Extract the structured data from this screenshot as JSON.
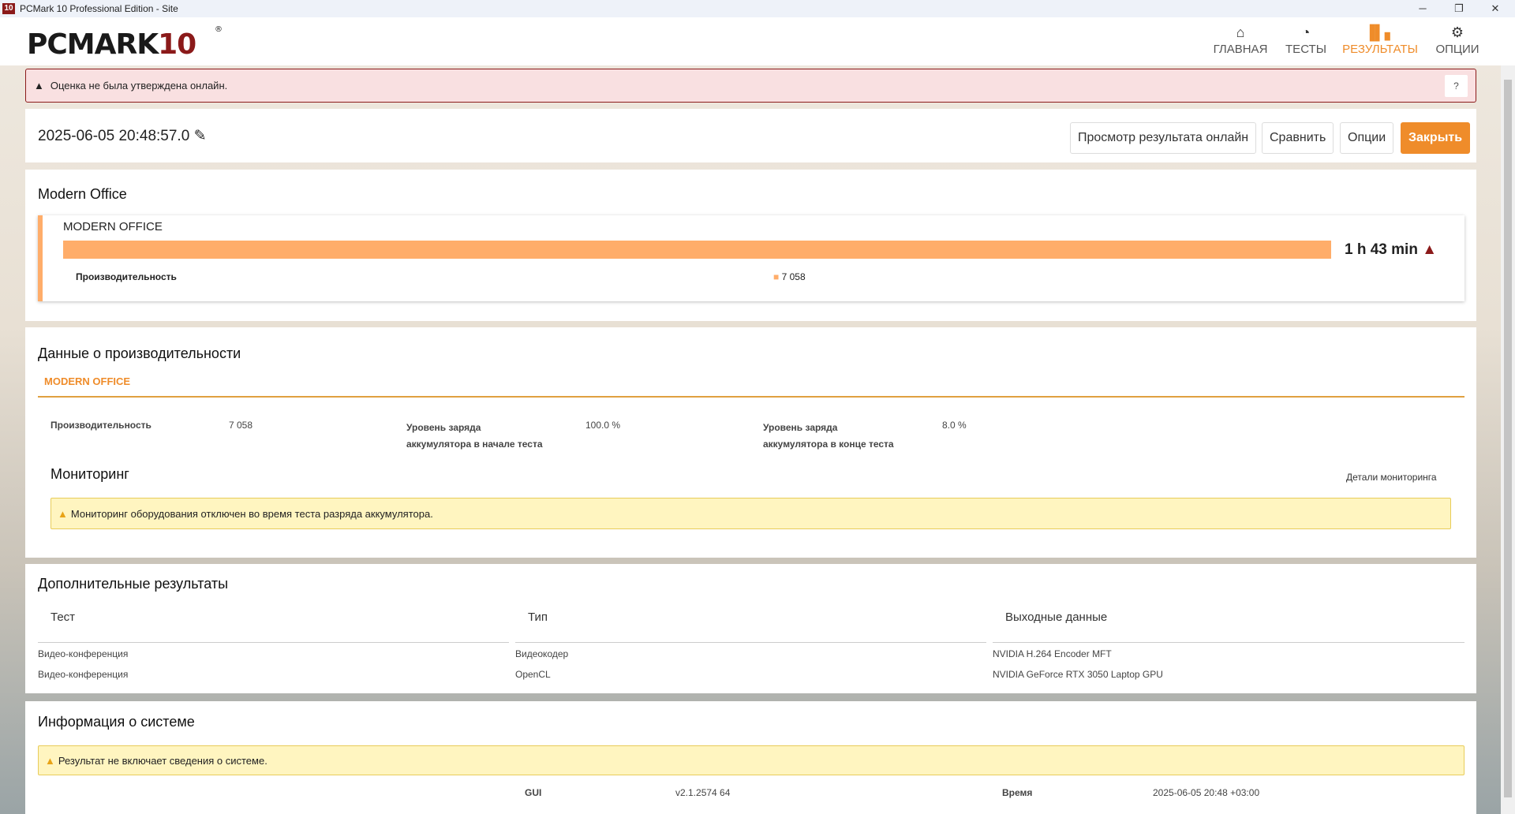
{
  "window": {
    "title": "PCMark 10 Professional Edition - Site",
    "logo": "10"
  },
  "brand": {
    "text": "PCMARK",
    "num": "10",
    "reg": "®"
  },
  "nav": [
    {
      "label": "ГЛАВНАЯ",
      "icon": "home-icon"
    },
    {
      "label": "ТЕСТЫ",
      "icon": "gauge-icon"
    },
    {
      "label": "РЕЗУЛЬТАТЫ",
      "icon": "bar-chart-icon",
      "active": true
    },
    {
      "label": "ОПЦИИ",
      "icon": "gear-icon"
    }
  ],
  "alert": {
    "text": "Оценка не была утверждена онлайн.",
    "help": "?"
  },
  "result": {
    "date": "2025-06-05 20:48:57.0",
    "buttons": {
      "online": "Просмотр результата онлайн",
      "compare": "Сравнить",
      "options": "Опции",
      "close": "Закрыть"
    }
  },
  "modern_office": {
    "section_title": "Modern Office",
    "card_title": "MODERN OFFICE",
    "score": "1 h 43 min",
    "bar_fill": 1.0,
    "sub_label": "Производительность",
    "sub_value": "7 058"
  },
  "perf": {
    "title": "Данные о производительности",
    "tab": "MODERN OFFICE",
    "items": [
      {
        "label": "Производительность",
        "value": "7 058"
      },
      {
        "label1": "Уровень заряда",
        "label2": "аккумулятора в начале теста",
        "value": "100.0 %"
      },
      {
        "label1": "Уровень заряда",
        "label2": "аккумулятора в конце теста",
        "value": "8.0 %"
      }
    ],
    "monitoring_title": "Мониторинг",
    "monitoring_link": "Детали мониторинга",
    "monitoring_warning": "Мониторинг оборудования отключен во время теста разряда аккумулятора."
  },
  "additional": {
    "title": "Дополнительные результаты",
    "headers": [
      "Тест",
      "Тип",
      "Выходные данные"
    ],
    "rows": [
      [
        "Видео-конференция",
        "Видеокодер",
        "NVIDIA H.264 Encoder MFT"
      ],
      [
        "Видео-конференция",
        "OpenCL",
        "NVIDIA GeForce RTX 3050 Laptop GPU"
      ]
    ]
  },
  "system": {
    "title": "Информация о системе",
    "warning": "Результат не включает сведения о системе.",
    "gui_label": "GUI",
    "gui_value": "v2.1.2574 64",
    "time_label": "Время",
    "time_value": "2025-06-05 20:48 +03:00"
  },
  "colors": {
    "accent": "#ef8c2a",
    "bar": "#ffad6a",
    "brand_red": "#8b1a1a"
  }
}
